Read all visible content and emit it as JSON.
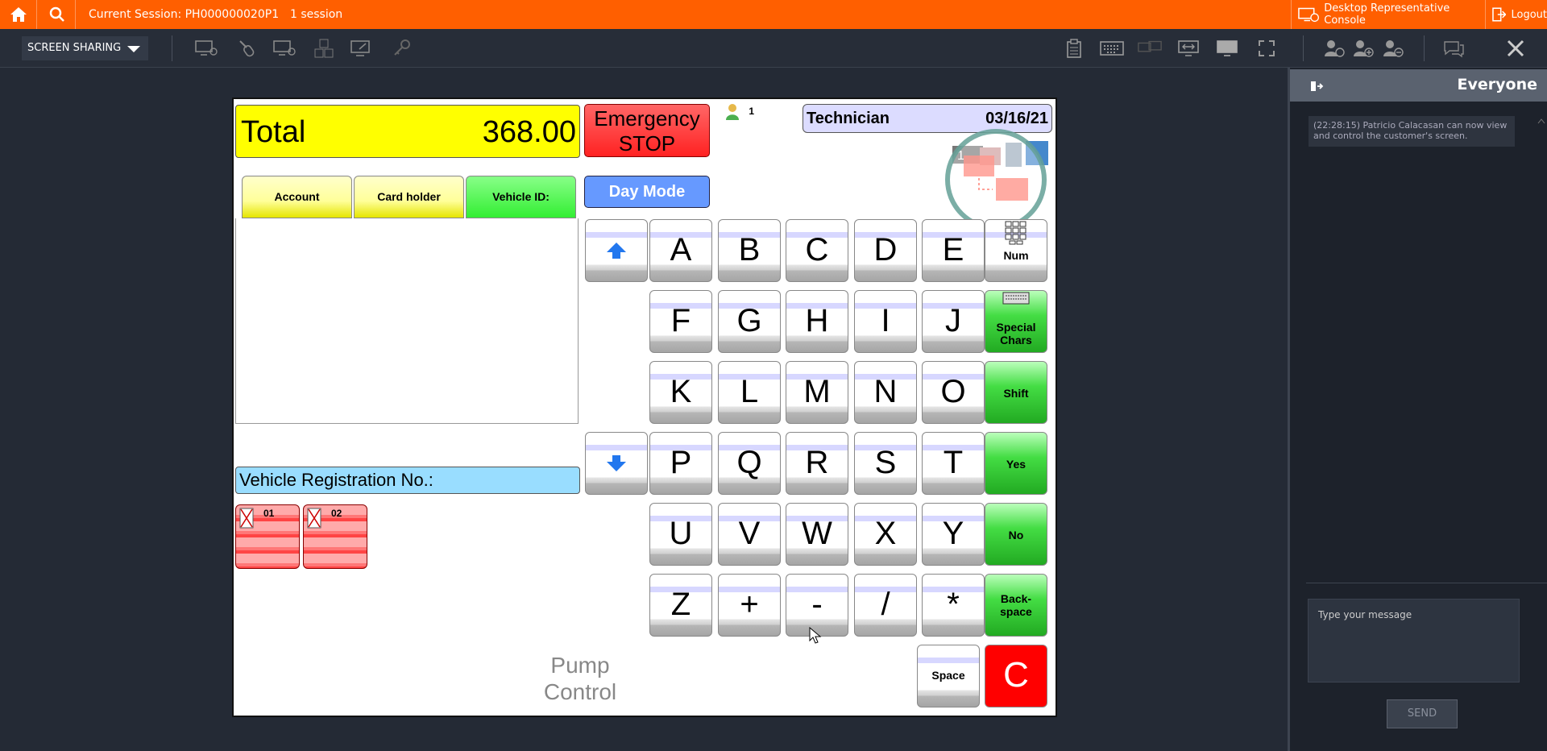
{
  "topbar": {
    "session_label": "Current Session: PH000000020P1",
    "session_count": "1 session",
    "console": "Desktop Representative Console",
    "logout": "Logout"
  },
  "toolbar": {
    "screen_sharing": "SCREEN SHARING"
  },
  "pos": {
    "total_label": "Total",
    "total_value": "368.00",
    "emergency_line1": "Emergency",
    "emergency_line2": "STOP",
    "user_count": "1",
    "technician": "Technician",
    "date": "03/16/21",
    "tabs": [
      "Account",
      "Card holder",
      "Vehicle ID:"
    ],
    "day_mode": "Day Mode",
    "vehicle_registration": "Vehicle Registration No.:",
    "pumps": [
      "01",
      "02"
    ],
    "pump_control_line1": "Pump",
    "pump_control_line2": "Control",
    "keys": [
      [
        "A",
        "B",
        "C",
        "D",
        "E"
      ],
      [
        "F",
        "G",
        "H",
        "I",
        "J"
      ],
      [
        "K",
        "L",
        "M",
        "N",
        "O"
      ],
      [
        "P",
        "Q",
        "R",
        "S",
        "T"
      ],
      [
        "U",
        "V",
        "W",
        "X",
        "Y"
      ],
      [
        "Z",
        "+",
        "-",
        "/",
        "*"
      ]
    ],
    "side_keys": {
      "num": "Num",
      "special1": "Special",
      "special2": "Chars",
      "shift": "Shift",
      "yes": "Yes",
      "no": "No",
      "back1": "Back-",
      "back2": "space",
      "space": "Space",
      "clear": "C"
    }
  },
  "chat": {
    "title": "Everyone",
    "message": "(22:28:15) Patricio Calacasan can now view and control the customer's screen.",
    "input_placeholder": "Type your message",
    "send": "SEND"
  },
  "colors": {
    "accent": "#ff5f00",
    "panel": "#1d222b"
  }
}
